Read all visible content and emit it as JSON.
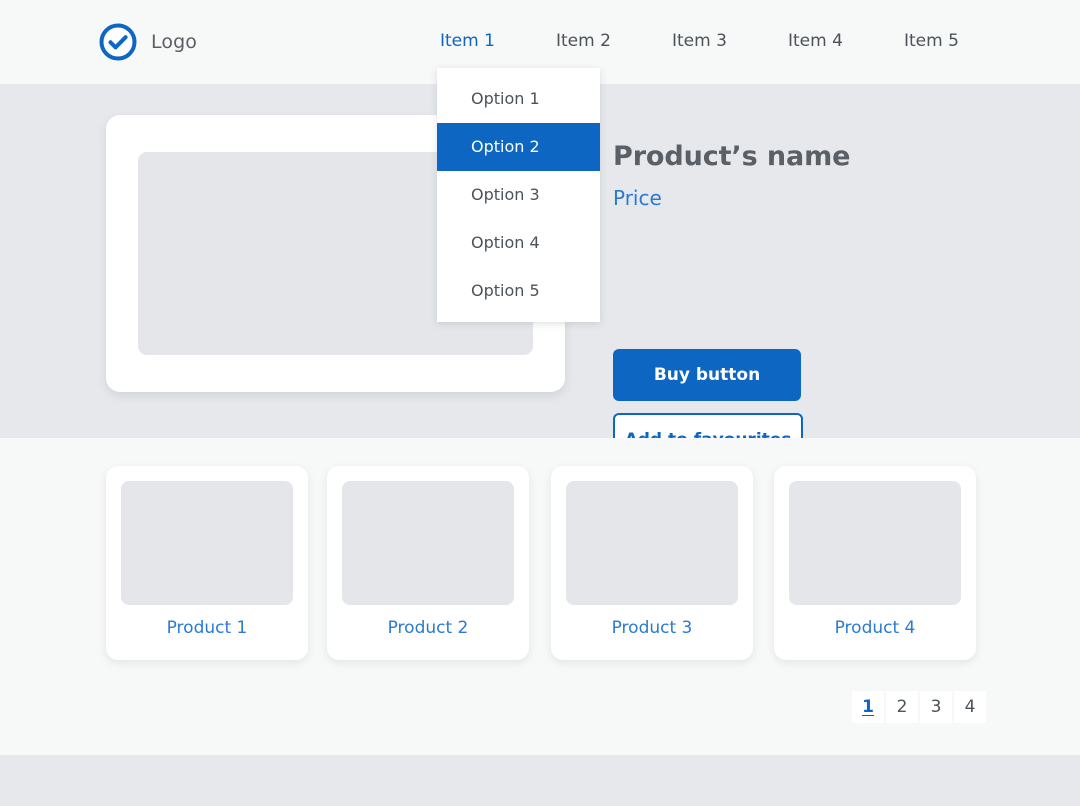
{
  "header": {
    "logo_icon": "check-circle-icon",
    "logo_text": "Logo",
    "nav_items": [
      {
        "label": "Item 1",
        "active": true
      },
      {
        "label": "Item 2",
        "active": false
      },
      {
        "label": "Item 3",
        "active": false
      },
      {
        "label": "Item 4",
        "active": false
      },
      {
        "label": "Item 5",
        "active": false
      }
    ]
  },
  "dropdown": {
    "open_for": "Item 1",
    "options": [
      {
        "label": "Option 1",
        "selected": false
      },
      {
        "label": "Option 2",
        "selected": true
      },
      {
        "label": "Option 3",
        "selected": false
      },
      {
        "label": "Option 4",
        "selected": false
      },
      {
        "label": "Option 5",
        "selected": false
      }
    ]
  },
  "detail": {
    "image_placeholder": "product-image-placeholder",
    "title": "Product’s name",
    "price": "Price",
    "buy_label": "Buy button",
    "favourite_label": "Add to favourites"
  },
  "grid": {
    "cards": [
      {
        "label": "Product 1"
      },
      {
        "label": "Product 2"
      },
      {
        "label": "Product 3"
      },
      {
        "label": "Product 4"
      }
    ]
  },
  "pagination": {
    "pages": [
      {
        "label": "1",
        "active": true
      },
      {
        "label": "2",
        "active": false
      },
      {
        "label": "3",
        "active": false
      },
      {
        "label": "4",
        "active": false
      }
    ]
  },
  "colors": {
    "accent_blue": "#0c66c2",
    "link_blue": "#2a7ad4",
    "text_gray": "#4c5358",
    "bg_gray": "#e6e8eb",
    "bg_light": "#f7f8f8",
    "placeholder_gray": "#e4e6ea"
  }
}
